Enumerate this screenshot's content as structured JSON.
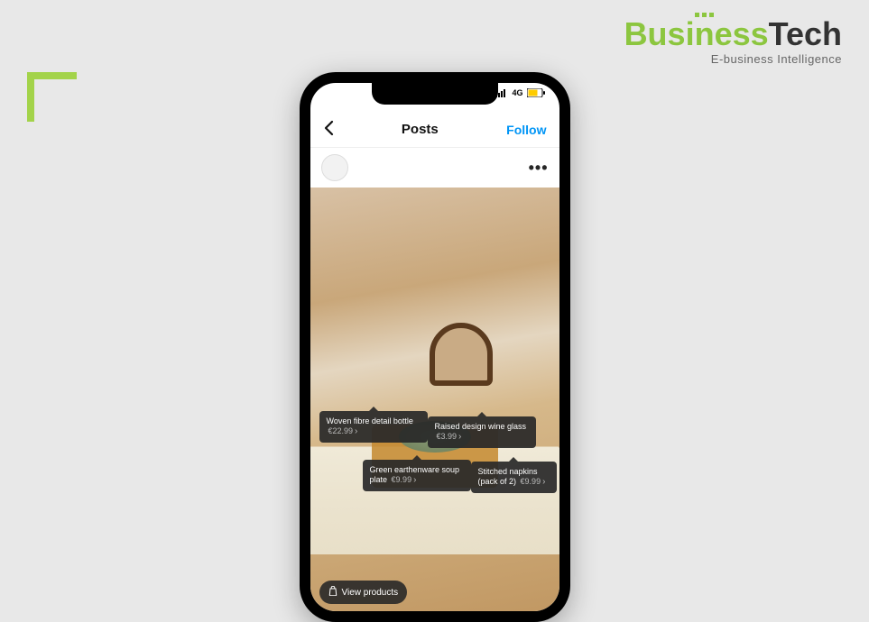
{
  "brand": {
    "name_part1": "Business",
    "name_part2": "Tech",
    "tagline": "E-business Intelligence"
  },
  "status": {
    "network": "4G"
  },
  "nav": {
    "title": "Posts",
    "follow_label": "Follow"
  },
  "tags": [
    {
      "label": "Woven fibre detail bottle",
      "price": "€22.99"
    },
    {
      "label": "Raised design wine glass",
      "price": "€3.99"
    },
    {
      "label": "Green earthenware soup plate",
      "price": "€9.99"
    },
    {
      "label": "Stitched napkins (pack of 2)",
      "price": "€9.99"
    }
  ],
  "view_products_label": "View products"
}
